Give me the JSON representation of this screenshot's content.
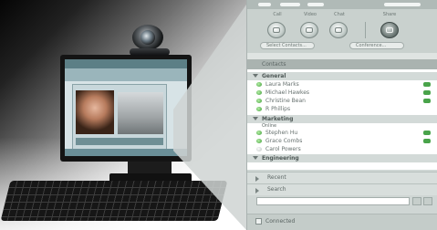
{
  "app": {
    "toolbar": {
      "labels": [
        "Call",
        "Video",
        "Chat",
        "Share"
      ],
      "pills": [
        "Select Contacts...",
        "Conference..."
      ]
    },
    "contacts_header": "Contacts",
    "groups": [
      {
        "name": "General",
        "contacts": [
          {
            "name": "Laura Marks",
            "status": "online"
          },
          {
            "name": "Michael Hawkes",
            "status": "online"
          },
          {
            "name": "Christine Bean",
            "status": "online"
          },
          {
            "name": "R Phillips",
            "status": "online"
          }
        ]
      },
      {
        "name": "Marketing",
        "subgroup": "Online",
        "contacts": [
          {
            "name": "Stephen Hu",
            "status": "online"
          },
          {
            "name": "Grace Combs",
            "status": "online"
          },
          {
            "name": "Carol Powers",
            "status": "away"
          }
        ]
      },
      {
        "name": "Engineering",
        "contacts": []
      }
    ],
    "recent_label": "Recent",
    "search_label": "Search",
    "search_placeholder": "",
    "connect_label": "Connected"
  },
  "colors": {
    "online": "#3a9a35",
    "camera": "#49a34a",
    "panel_bg": "#dfe4e2"
  }
}
